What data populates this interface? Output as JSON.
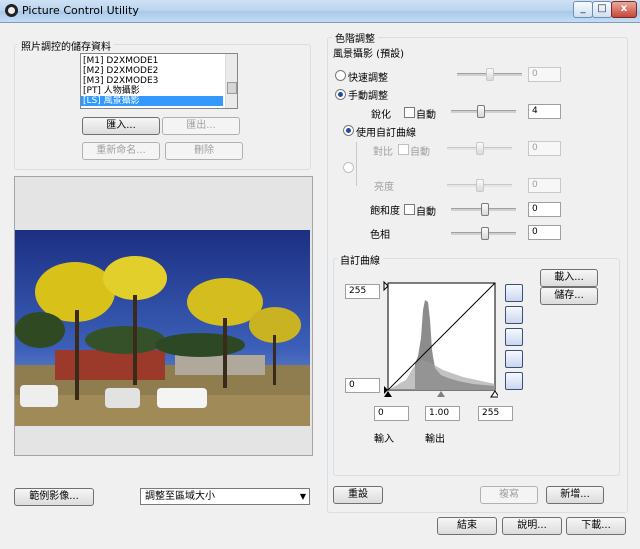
{
  "window": {
    "title": "Picture Control Utility",
    "min_glyph": "_",
    "max_glyph": "□",
    "close_glyph": "x"
  },
  "storage": {
    "group_label": "照片調控的儲存資料",
    "items": [
      "[M1] D2XMODE1",
      "[M2] D2XMODE2",
      "[M3] D2XMODE3",
      "[PT] 人物攝影",
      "[LS] 風景攝影"
    ],
    "selected_index": 4,
    "import_label": "匯入...",
    "export_label": "匯出...",
    "rename_label": "重新命名...",
    "delete_label": "刪除"
  },
  "preview": {
    "sample_image_label": "範例影像...",
    "fit_select_value": "調整至區域大小"
  },
  "adjust": {
    "group_label": "色階調整",
    "preset_name": "風景攝影 (預設)",
    "quick_label": "快速調整",
    "quick_value": "0",
    "manual_label": "手動調整",
    "sharpening_label": "銳化",
    "sharpening_auto": "自動",
    "sharpening_value": "4",
    "use_curve_label": "使用自訂曲線",
    "contrast_label": "對比",
    "contrast_auto": "自動",
    "contrast_value": "0",
    "brightness_label": "亮度",
    "brightness_value": "0",
    "saturation_label": "飽和度",
    "saturation_auto": "自動",
    "saturation_value": "0",
    "hue_label": "色相",
    "hue_value": "0"
  },
  "curve": {
    "group_label": "自訂曲線",
    "load_label": "載入...",
    "save_label": "儲存...",
    "output_max": "255",
    "output_min": "0",
    "input_black": "0",
    "gamma": "1.00",
    "input_white": "255",
    "input_label": "輸入",
    "output_label": "輸出"
  },
  "footer": {
    "reset_label": "重設",
    "copy_label": "複寫",
    "new_label": "新增...",
    "close_label": "結束",
    "help_label": "說明...",
    "download_label": "下載..."
  }
}
